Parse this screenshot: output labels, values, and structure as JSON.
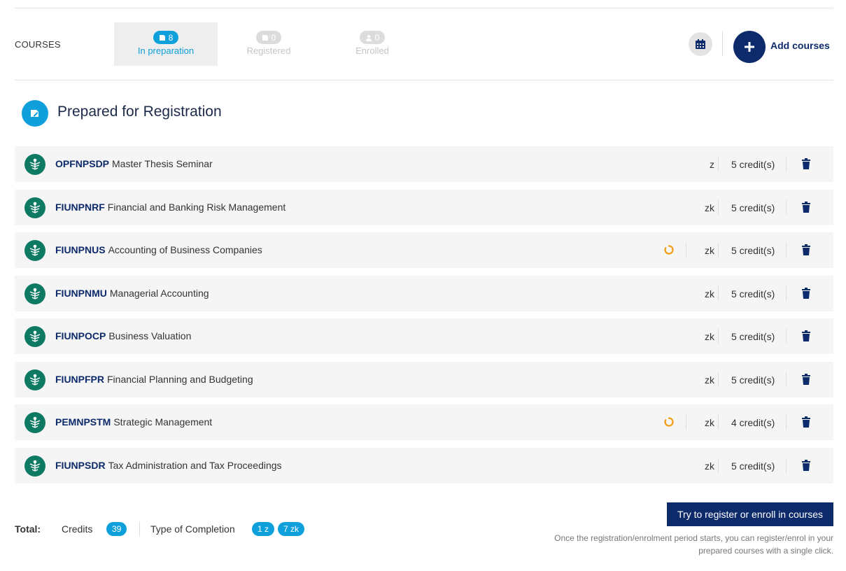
{
  "header": {
    "courses_label": "COURSES",
    "tabs": [
      {
        "label": "In preparation",
        "count": "8",
        "icon": "note-icon",
        "active": true
      },
      {
        "label": "Registered",
        "count": "0",
        "icon": "note-icon",
        "active": false
      },
      {
        "label": "Enrolled",
        "count": "0",
        "icon": "person-icon",
        "active": false
      }
    ],
    "calendar_icon": "calendar-icon",
    "add_courses_label": "Add courses"
  },
  "section": {
    "title": "Prepared for Registration",
    "icon": "edit-note-icon"
  },
  "courses": [
    {
      "code": "OPFNPSDP",
      "name": "Master Thesis Seminar",
      "completion": "z",
      "credits": "5 credit(s)",
      "pending": false
    },
    {
      "code": "FIUNPNRF",
      "name": "Financial and Banking Risk Management",
      "completion": "zk",
      "credits": "5 credit(s)",
      "pending": false
    },
    {
      "code": "FIUNPNUS",
      "name": "Accounting of Business Companies",
      "completion": "zk",
      "credits": "5 credit(s)",
      "pending": true
    },
    {
      "code": "FIUNPNMU",
      "name": "Managerial Accounting",
      "completion": "zk",
      "credits": "5 credit(s)",
      "pending": false
    },
    {
      "code": "FIUNPOCP",
      "name": "Business Valuation",
      "completion": "zk",
      "credits": "5 credit(s)",
      "pending": false
    },
    {
      "code": "FIUNPFPR",
      "name": "Financial Planning and Budgeting",
      "completion": "zk",
      "credits": "5 credit(s)",
      "pending": false
    },
    {
      "code": "PEMNPSTM",
      "name": "Strategic Management",
      "completion": "zk",
      "credits": "4 credit(s)",
      "pending": true
    },
    {
      "code": "FIUNPSDR",
      "name": "Tax Administration and Tax Proceedings",
      "completion": "zk",
      "credits": "5 credit(s)",
      "pending": false
    }
  ],
  "footer": {
    "total_label": "Total:",
    "credits_label": "Credits",
    "credits_value": "39",
    "completion_label": "Type of Completion",
    "completion_badges": [
      "1 z",
      "7 zk"
    ],
    "register_button": "Try to register or enroll in courses",
    "note_line1": "Once the registration/enrolment period starts, you can register/enrol in your",
    "note_line2": "prepared courses with a single click."
  },
  "colors": {
    "accent": "#0fa0dc",
    "navy": "#0d2a6b",
    "faculty_green": "#0f7a63",
    "pending_orange": "#f39c12"
  }
}
